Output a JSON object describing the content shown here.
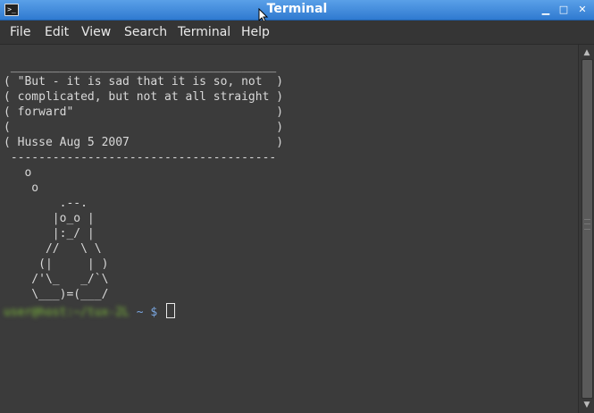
{
  "window": {
    "title": "Terminal",
    "icon": "terminal-icon",
    "controls": {
      "minimize": "▁",
      "maximize": "□",
      "close": "✕"
    }
  },
  "menu": {
    "file": "File",
    "edit": "Edit",
    "view": "View",
    "search": "Search",
    "terminal": "Terminal",
    "help": "Help"
  },
  "output": {
    "text": " ______________________________________\n( \"But - it is sad that it is so, not  )\n( complicated, but not at all straight )\n( forward\"                             )\n(                                      )\n( Husse Aug 5 2007                     )\n --------------------------------------\n   o\n    o\n        .--.\n       |o_o |\n       |:_/ |\n      //   \\ \\\n     (|     | )\n    /'\\_   _/`\\\n    \\___)=(___/"
  },
  "prompt": {
    "user_host": "user@host:~/tux-2L",
    "path": " ~ $ "
  },
  "colors": {
    "titlebar": "#2f7ad0",
    "background": "#3b3b3b",
    "text": "#d8d8d8",
    "prompt_user": "#7fbf3a",
    "prompt_path": "#7aa6e0"
  }
}
